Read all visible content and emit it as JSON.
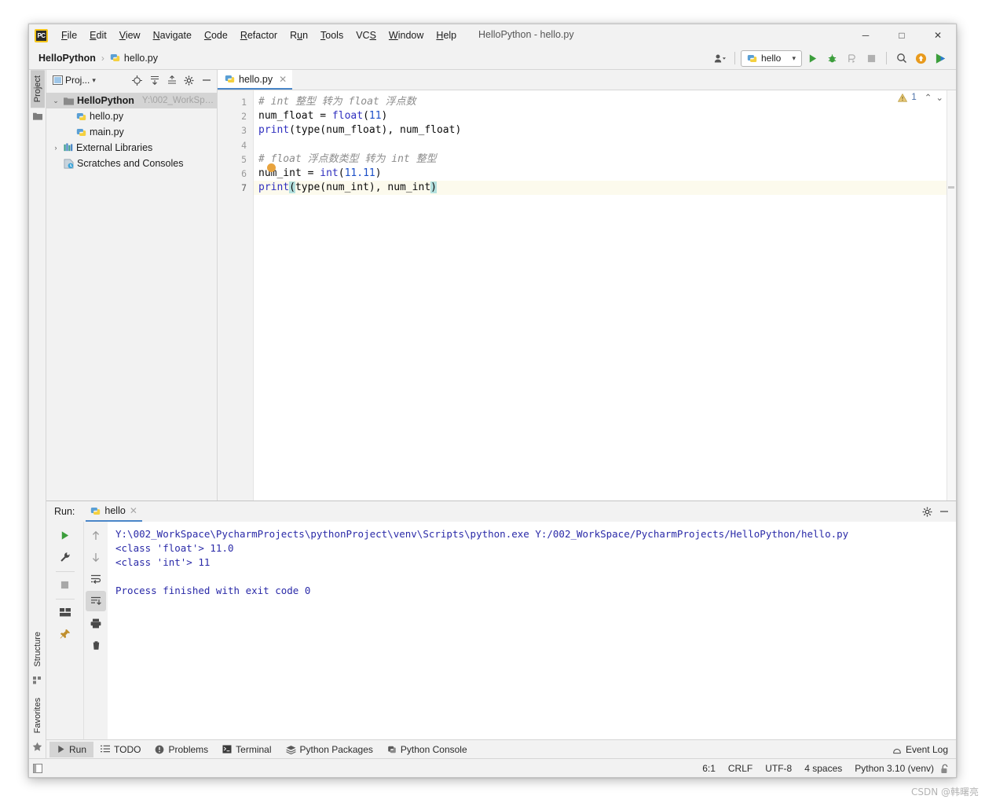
{
  "window": {
    "title": "HelloPython - hello.py",
    "minimize_label": "─",
    "maximize_label": "□",
    "close_label": "✕",
    "logo_text": "PC"
  },
  "menubar": {
    "items": [
      {
        "pre": "",
        "u": "F",
        "post": "ile"
      },
      {
        "pre": "",
        "u": "E",
        "post": "dit"
      },
      {
        "pre": "",
        "u": "V",
        "post": "iew"
      },
      {
        "pre": "",
        "u": "N",
        "post": "avigate"
      },
      {
        "pre": "",
        "u": "C",
        "post": "ode"
      },
      {
        "pre": "",
        "u": "R",
        "post": "efactor"
      },
      {
        "pre": "R",
        "u": "u",
        "post": "n"
      },
      {
        "pre": "",
        "u": "T",
        "post": "ools"
      },
      {
        "pre": "VC",
        "u": "S",
        "post": ""
      },
      {
        "pre": "",
        "u": "W",
        "post": "indow"
      },
      {
        "pre": "",
        "u": "H",
        "post": "elp"
      }
    ]
  },
  "breadcrumb": {
    "project": "HelloPython",
    "separator": "›",
    "file": "hello.py"
  },
  "toolbar": {
    "run_config": "hello",
    "dropdown_caret": "▾",
    "icons": [
      {
        "name": "user-avatar-icon",
        "glyph": "👤"
      },
      {
        "name": "run-icon",
        "glyph": "▶"
      },
      {
        "name": "debug-icon",
        "glyph": "🐞"
      },
      {
        "name": "run-coverage-icon",
        "glyph": "↻"
      },
      {
        "name": "stop-icon",
        "glyph": "■"
      },
      {
        "name": "search-everywhere-icon",
        "glyph": "🔍"
      },
      {
        "name": "update-project-icon",
        "glyph": "⬆"
      },
      {
        "name": "run-anything-icon",
        "glyph": "▶"
      }
    ]
  },
  "rail": {
    "top": [
      {
        "label": "Project",
        "icon": "folder-icon",
        "active": true
      }
    ],
    "bottom": [
      {
        "label": "Structure",
        "icon": "structure-icon",
        "active": false
      },
      {
        "label": "Favorites",
        "icon": "star-icon",
        "active": false
      }
    ]
  },
  "project_panel": {
    "title": "Proj...",
    "title_caret": "▾",
    "header_icons": [
      {
        "name": "locate-icon",
        "glyph": "⊕"
      },
      {
        "name": "expand-all-icon",
        "glyph": "⤓"
      },
      {
        "name": "collapse-all-icon",
        "glyph": "⤒"
      },
      {
        "name": "settings-gear-icon",
        "glyph": "⚙"
      },
      {
        "name": "hide-panel-icon",
        "glyph": "─"
      }
    ],
    "tree": [
      {
        "label": "HelloPython",
        "path": "Y:\\002_WorkSp…",
        "twisty": "⌄",
        "icon": "folder-icon",
        "depth": 0,
        "bold": true,
        "selected": true
      },
      {
        "label": "hello.py",
        "path": "",
        "twisty": "",
        "icon": "python-file-icon",
        "depth": 1,
        "bold": false,
        "selected": false
      },
      {
        "label": "main.py",
        "path": "",
        "twisty": "",
        "icon": "python-file-icon",
        "depth": 1,
        "bold": false,
        "selected": false
      },
      {
        "label": "External Libraries",
        "path": "",
        "twisty": "›",
        "icon": "library-icon",
        "depth": 0,
        "bold": false,
        "selected": false
      },
      {
        "label": "Scratches and Consoles",
        "path": "",
        "twisty": "",
        "icon": "scratches-icon",
        "depth": 0,
        "bold": false,
        "selected": false
      }
    ]
  },
  "editor": {
    "tab": {
      "label": "hello.py",
      "close": "✕",
      "icon": "python-file-icon"
    },
    "inspection": {
      "warning_count": "1",
      "warning_glyph": "⚠",
      "up": "⌃",
      "down": "⌄"
    },
    "line_numbers": [
      "1",
      "2",
      "3",
      "4",
      "5",
      "6",
      "7"
    ],
    "current_line": 7,
    "lines": [
      {
        "n": 1,
        "tokens": [
          {
            "t": "# int 整型 转为 float 浮点数",
            "c": "cmt"
          }
        ]
      },
      {
        "n": 2,
        "tokens": [
          {
            "t": "num_float = ",
            "c": ""
          },
          {
            "t": "float",
            "c": "kw"
          },
          {
            "t": "(",
            "c": ""
          },
          {
            "t": "11",
            "c": "num"
          },
          {
            "t": ")",
            "c": ""
          }
        ]
      },
      {
        "n": 3,
        "tokens": [
          {
            "t": "print",
            "c": "kw"
          },
          {
            "t": "(type(num_float), num_float)",
            "c": ""
          }
        ]
      },
      {
        "n": 4,
        "tokens": [
          {
            "t": "",
            "c": ""
          }
        ]
      },
      {
        "n": 5,
        "tokens": [
          {
            "t": "# float 浮点数类型 转为 int 整型",
            "c": "cmt"
          }
        ]
      },
      {
        "n": 6,
        "tokens": [
          {
            "t": "num_int = ",
            "c": ""
          },
          {
            "t": "int",
            "c": "kw"
          },
          {
            "t": "(",
            "c": ""
          },
          {
            "t": "11.11",
            "c": "num"
          },
          {
            "t": ")",
            "c": ""
          }
        ]
      },
      {
        "n": 7,
        "tokens": [
          {
            "t": "print",
            "c": "kw"
          },
          {
            "t": "(",
            "c": "mpar"
          },
          {
            "t": "type(num_int), num_int",
            "c": ""
          },
          {
            "t": ")",
            "c": "mpar"
          }
        ]
      }
    ]
  },
  "run_panel": {
    "label": "Run:",
    "tab": {
      "label": "hello",
      "close": "✕",
      "icon": "python-icon"
    },
    "header_icons": [
      {
        "name": "settings-gear-icon",
        "glyph": "⚙"
      },
      {
        "name": "hide-panel-icon",
        "glyph": "─"
      }
    ],
    "tools_left": [
      {
        "name": "rerun-icon",
        "glyph": "▶"
      },
      {
        "name": "wrench-icon",
        "glyph": "🔧"
      },
      {
        "name": "stop-icon",
        "glyph": "■"
      },
      {
        "name": "layout-icon",
        "glyph": "▤"
      },
      {
        "name": "pin-icon",
        "glyph": "📌"
      }
    ],
    "tools_right": [
      {
        "name": "up-arrow-icon",
        "glyph": "↑",
        "on": false
      },
      {
        "name": "down-arrow-icon",
        "glyph": "↓",
        "on": false
      },
      {
        "name": "soft-wrap-icon",
        "glyph": "↩",
        "on": false
      },
      {
        "name": "scroll-to-end-icon",
        "glyph": "⤓",
        "on": true
      },
      {
        "name": "print-icon",
        "glyph": "🖨",
        "on": false
      },
      {
        "name": "clear-all-icon",
        "glyph": "🗑",
        "on": false
      }
    ],
    "console_lines": [
      "Y:\\002_WorkSpace\\PycharmProjects\\pythonProject\\venv\\Scripts\\python.exe Y:/002_WorkSpace/PycharmProjects/HelloPython/hello.py",
      "<class 'float'> 11.0",
      "<class 'int'> 11",
      "",
      "Process finished with exit code 0"
    ]
  },
  "bottom_tabs": [
    {
      "label": "Run",
      "icon": "run-icon",
      "glyph": "▶",
      "active": true
    },
    {
      "label": "TODO",
      "icon": "todo-icon",
      "glyph": "☰",
      "active": false
    },
    {
      "label": "Problems",
      "icon": "problems-icon",
      "glyph": "ⓘ",
      "active": false
    },
    {
      "label": "Terminal",
      "icon": "terminal-icon",
      "glyph": "▣",
      "active": false
    },
    {
      "label": "Python Packages",
      "icon": "packages-icon",
      "glyph": "≣",
      "active": false
    },
    {
      "label": "Python Console",
      "icon": "python-console-icon",
      "glyph": "⎇",
      "active": false
    }
  ],
  "event_log": {
    "label": "Event Log",
    "icon": "bell-icon",
    "glyph": "◯"
  },
  "status_bar": {
    "caret_position": "6:1",
    "line_separator": "CRLF",
    "encoding": "UTF-8",
    "indent": "4 spaces",
    "interpreter": "Python 3.10 (venv)",
    "lock_icon": "🔓"
  },
  "watermark": "CSDN @韩曙亮",
  "colors": {
    "accent_blue": "#4a86c8",
    "keyword": "#2f2fbf",
    "comment": "#8c8c8c",
    "number": "#1d50c8",
    "console_text": "#2a2aa8",
    "match_paren": "#b3e0de",
    "caret_marker": "#e8a33d",
    "current_line": "#fcfaed"
  }
}
